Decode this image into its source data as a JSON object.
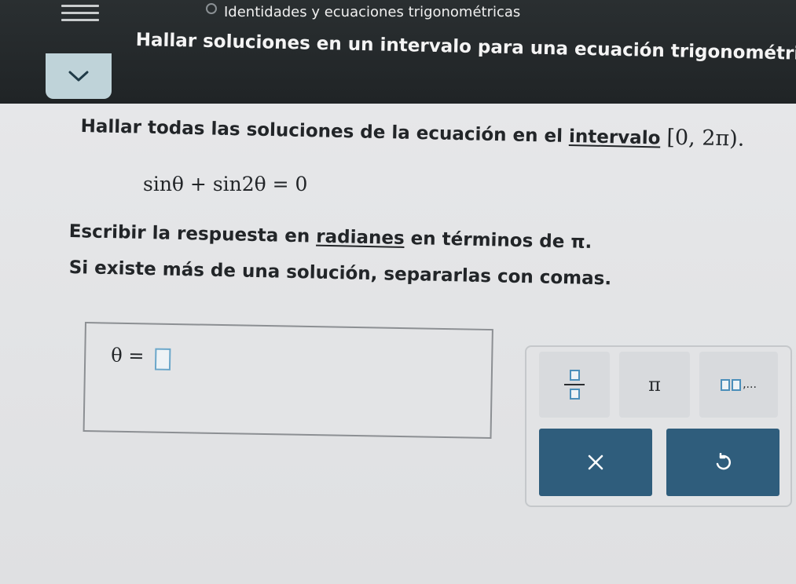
{
  "header": {
    "topic": "Identidades y ecuaciones trigonométricas",
    "title": "Hallar soluciones en un intervalo para una ecuación trigonométrica que..."
  },
  "problem": {
    "prompt_text": "Hallar todas las soluciones de la ecuación en el ",
    "interval_link": "intervalo",
    "interval": "[0, 2π).",
    "equation": "sinθ + sin2θ = 0",
    "instruction_prefix": "Escribir la respuesta en ",
    "radians_link": "radianes",
    "instruction_suffix": " en términos de π.",
    "multiple_note": "Si existe más de una solución, separarlas con comas."
  },
  "answer": {
    "variable_label": "θ =",
    "value": ""
  },
  "tools": {
    "pi_symbol": "π",
    "list_ellipsis": ",..."
  },
  "icons": {
    "menu": "hamburger-menu-icon",
    "collapse": "chevron-down-icon",
    "fraction": "fraction-icon",
    "pi": "pi-icon",
    "list": "list-icon",
    "clear": "x-icon",
    "undo": "undo-icon"
  },
  "colors": {
    "header_bg": "#202426",
    "collapse_bg": "#bfd3d9",
    "action_button_bg": "#2f5d7c",
    "input_border": "#6aa6c9"
  }
}
